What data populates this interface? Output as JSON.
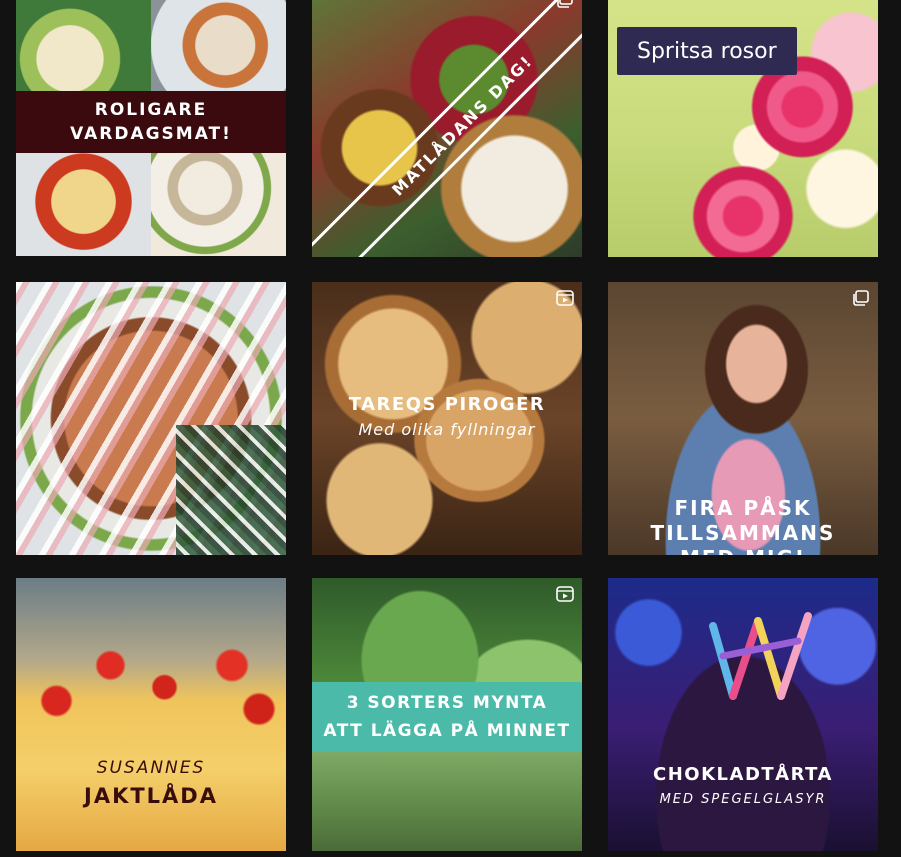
{
  "posts": [
    {
      "overlay_lines": [
        "ROLIGARE",
        "VARDAGSMAT!"
      ],
      "media_icon": ""
    },
    {
      "overlay_text": "MATLÅDANS DAG!",
      "media_icon": "carousel-icon"
    },
    {
      "overlay_text": "Spritsa rosor",
      "media_icon": ""
    },
    {
      "overlay_text": "",
      "media_icon": ""
    },
    {
      "title": "TAREQS PIROGER",
      "subtitle": "Med olika fyllningar",
      "media_icon": "reel-icon"
    },
    {
      "overlay_lines": [
        "FIRA PÅSK",
        "TILLSAMMANS",
        "MED MIG!"
      ],
      "media_icon": "carousel-icon"
    },
    {
      "small": "SUSANNES",
      "big": "JAKTLÅDA",
      "media_icon": ""
    },
    {
      "overlay_lines": [
        "3 SORTERS MYNTA",
        "ATT LÄGGA PÅ MINNET"
      ],
      "media_icon": "reel-icon"
    },
    {
      "title": "CHOKLADTÅRTA",
      "subtitle": "MED SPEGELGLASYR",
      "media_icon": ""
    }
  ]
}
